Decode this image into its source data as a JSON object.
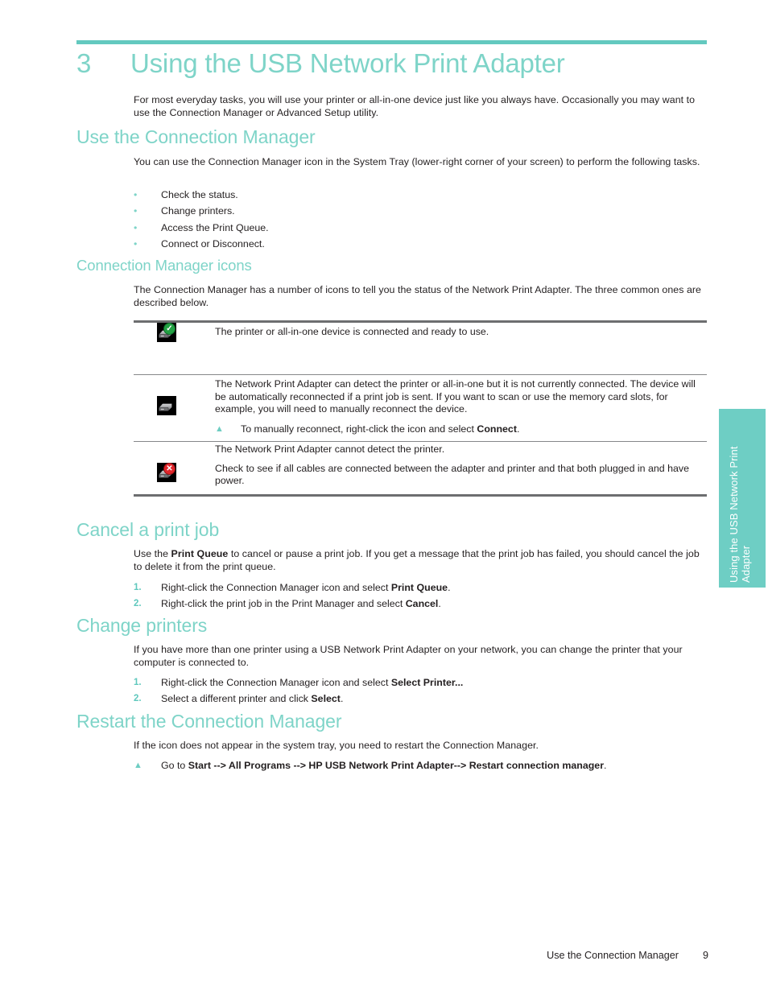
{
  "chapter": {
    "number": "3",
    "title": "Using the USB Network Print Adapter",
    "intro": "For most everyday tasks, you will use your printer or all-in-one device just like you always have. Occasionally you may want to use the Connection Manager or Advanced Setup utility."
  },
  "sections": {
    "use_connection_manager": {
      "heading": "Use the Connection Manager",
      "intro": "You can use the Connection Manager icon in the System Tray (lower-right corner of your screen) to perform the following tasks.",
      "bullets": [
        "Check the status.",
        "Change printers.",
        "Access the Print Queue.",
        "Connect or Disconnect."
      ]
    },
    "connection_manager_icons": {
      "heading": "Connection Manager icons",
      "intro": "The Connection Manager has a number of icons to tell you the status of the Network Print Adapter. The three common ones are described below.",
      "rows": [
        {
          "icon": "device-connected-icon",
          "badge": "check",
          "text": "The printer or all-in-one device is connected and ready to use."
        },
        {
          "icon": "device-disconnected-icon",
          "badge": "none",
          "text": "The Network Print Adapter can detect the printer or all-in-one but it is not currently connected. The device will be automatically reconnected if a print job is sent. If you want to scan or use the memory card slots, for example, you will need to manually reconnect the device.",
          "note_marker": "▲",
          "note_pre": "To manually reconnect, right-click the icon and select ",
          "note_bold": "Connect",
          "note_post": "."
        },
        {
          "icon": "device-error-icon",
          "badge": "error",
          "text": "The Network Print Adapter cannot detect the printer.",
          "text2": "Check to see if all cables are connected between the adapter and printer and that both plugged in and have power."
        }
      ]
    },
    "cancel_print_job": {
      "heading": "Cancel a print job",
      "intro_pre": "Use the ",
      "intro_bold": "Print Queue",
      "intro_post": " to cancel or pause a print job. If you get a message that the print job has failed, you should cancel the job to delete it from the print queue.",
      "steps": [
        {
          "num": "1.",
          "pre": "Right-click the Connection Manager icon and select ",
          "bold": "Print Queue",
          "post": "."
        },
        {
          "num": "2.",
          "pre": "Right-click the print job in the Print Manager and select ",
          "bold": "Cancel",
          "post": "."
        }
      ]
    },
    "change_printers": {
      "heading": "Change printers",
      "intro": "If you have more than one printer using a USB Network Print Adapter on your network, you can change the printer that your computer is connected to.",
      "steps": [
        {
          "num": "1.",
          "pre": "Right-click the Connection Manager icon and select ",
          "bold": "Select Printer...",
          "post": ""
        },
        {
          "num": "2.",
          "pre": "Select a different printer and click ",
          "bold": "Select",
          "post": "."
        }
      ]
    },
    "restart_connection_manager": {
      "heading": "Restart the Connection Manager",
      "intro": "If the icon does not appear in the system tray, you need to restart the Connection Manager.",
      "note_marker": "▲",
      "note_pre": "Go to ",
      "note_bold": "Start --> All Programs --> HP USB Network Print Adapter--> Restart connection manager",
      "note_post": "."
    }
  },
  "side_tab": {
    "label": "Using the USB Network Print Adapter"
  },
  "footer": {
    "text": "Use the Connection Manager",
    "page": "9"
  },
  "bullet_glyph": "•",
  "colors": {
    "accent_heading": "#7ed4c8",
    "accent_rule": "#63c9bf",
    "accent_tab": "#6ecec4",
    "text": "#231f20",
    "table_rule_thick": "#6d6e70",
    "table_rule_thin": "#868789"
  }
}
